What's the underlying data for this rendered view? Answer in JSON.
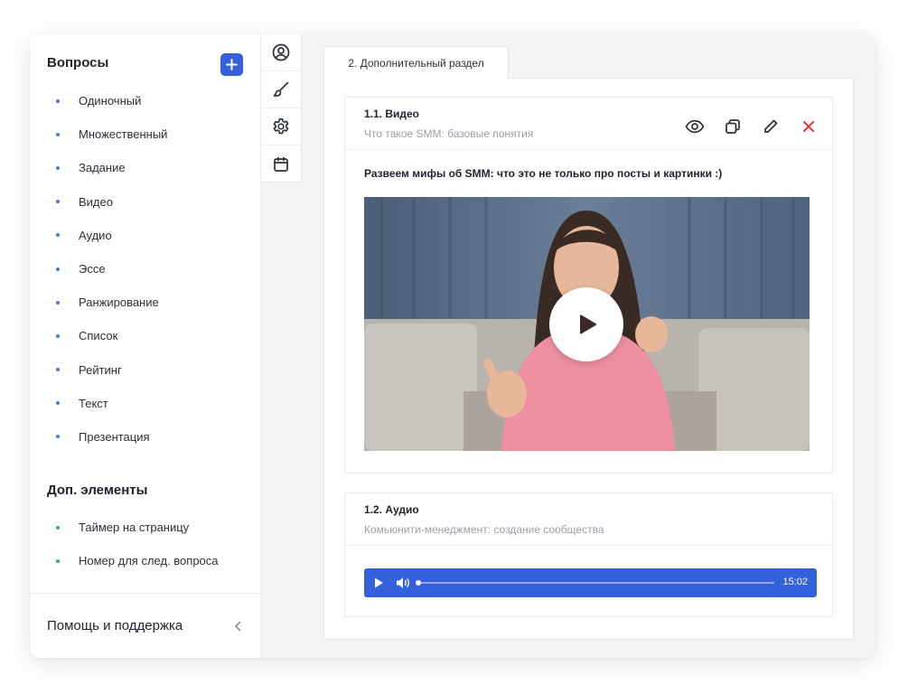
{
  "sidebar": {
    "questions_heading": "Вопросы",
    "questions": [
      {
        "label": "Одиночный"
      },
      {
        "label": "Множественный"
      },
      {
        "label": "Задание"
      },
      {
        "label": "Видео"
      },
      {
        "label": "Аудио"
      },
      {
        "label": "Эссе"
      },
      {
        "label": "Ранжирование"
      },
      {
        "label": "Список"
      },
      {
        "label": "Рейтинг"
      },
      {
        "label": "Текст"
      },
      {
        "label": "Презентация"
      }
    ],
    "extras_heading": "Доп. элементы",
    "extras": [
      {
        "label": "Таймер на страницу"
      },
      {
        "label": "Номер для след. вопроса"
      }
    ],
    "help_label": "Помощь и поддержка",
    "bullet_color_questions": "#4a7bd0",
    "bullet_color_extras": "#45b060"
  },
  "rail": {
    "icons": [
      "user-circle-icon",
      "brush-icon",
      "gear-icon",
      "calendar-icon"
    ]
  },
  "content": {
    "tab_label": "2. Дополнительный раздел",
    "video_card": {
      "title": "1.1. Видео",
      "subtitle": "Что такое SMM: базовые понятия",
      "description": "Развеем мифы об SMM: что это не только про посты и картинки :)"
    },
    "audio_card": {
      "title": "1.2. Аудио",
      "subtitle": "Комьюнити-менеджмент: создание сообщества",
      "duration": "15:02",
      "progress": 0
    }
  },
  "colors": {
    "accent": "#3460dc",
    "delete": "#e0393e"
  }
}
